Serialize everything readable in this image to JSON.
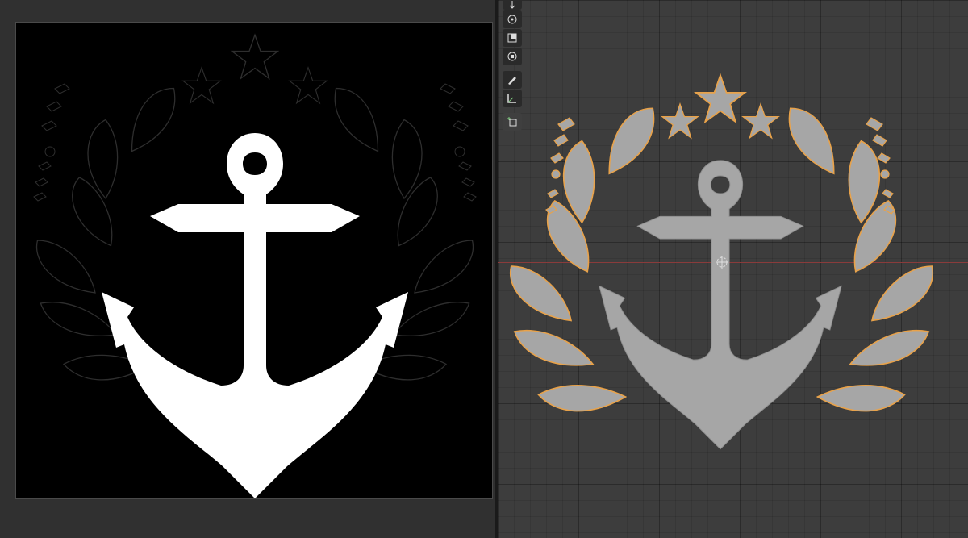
{
  "image_editor": {
    "canvas_background": "#000000",
    "emblem_fill": "#ffffff",
    "outline_color": "#2e2e2e"
  },
  "viewport": {
    "grid_color": "#3d3d3d",
    "mesh_fill": "#a6a6a6",
    "selection_outline": "#e8a24a",
    "x_axis_color": "#8a3b3b"
  },
  "toolbar": {
    "tools": [
      {
        "name": "move",
        "icon": "move-icon"
      },
      {
        "name": "rotate",
        "icon": "rotate-icon"
      },
      {
        "name": "scale",
        "icon": "scale-icon"
      },
      {
        "name": "transform",
        "icon": "transform-icon"
      },
      {
        "name": "annotate",
        "icon": "annotate-icon"
      },
      {
        "name": "measure",
        "icon": "measure-icon"
      },
      {
        "name": "add-cube",
        "icon": "add-cube-icon"
      }
    ]
  }
}
